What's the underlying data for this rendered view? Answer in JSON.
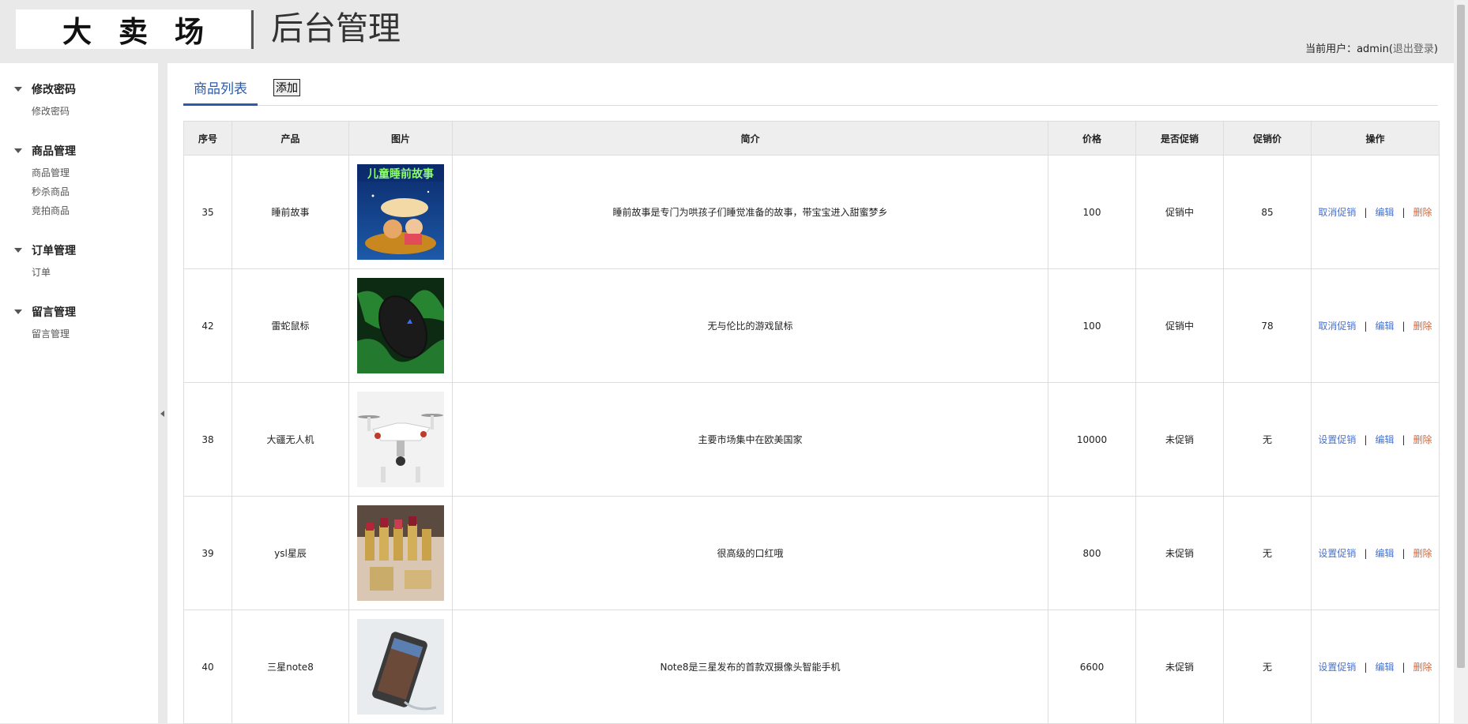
{
  "header": {
    "logo": "大卖场",
    "title": "后台管理",
    "user_prefix": "当前用户：admin(",
    "logout": "退出登录",
    "user_suffix": ")"
  },
  "sidebar": {
    "groups": [
      {
        "title": "修改密码",
        "items": [
          "修改密码"
        ]
      },
      {
        "title": "商品管理",
        "items": [
          "商品管理",
          "秒杀商品",
          "竞拍商品"
        ]
      },
      {
        "title": "订单管理",
        "items": [
          "订单"
        ]
      },
      {
        "title": "留言管理",
        "items": [
          "留言管理"
        ]
      }
    ]
  },
  "main": {
    "tab": "商品列表",
    "add_button": "添加",
    "columns": [
      "序号",
      "产品",
      "图片",
      "简介",
      "价格",
      "是否促销",
      "促销价",
      "操作"
    ],
    "ops": {
      "edit": "编辑",
      "delete": "删除",
      "sep": "|"
    },
    "rows": [
      {
        "id": "35",
        "product": "睡前故事",
        "desc": "睡前故事是专门为哄孩子们睡觉准备的故事，带宝宝进入甜蜜梦乡",
        "price": "100",
        "promo": "促销中",
        "promo_price": "85",
        "promo_op": "取消促销",
        "image_text": "儿童睡前故事"
      },
      {
        "id": "42",
        "product": "雷蛇鼠标",
        "desc": "无与伦比的游戏鼠标",
        "price": "100",
        "promo": "促销中",
        "promo_price": "78",
        "promo_op": "取消促销"
      },
      {
        "id": "38",
        "product": "大疆无人机",
        "desc": "主要市场集中在欧美国家",
        "price": "10000",
        "promo": "未促销",
        "promo_price": "无",
        "promo_op": "设置促销"
      },
      {
        "id": "39",
        "product": "ysl星辰",
        "desc": "很高级的口红哦",
        "price": "800",
        "promo": "未促销",
        "promo_price": "无",
        "promo_op": "设置促销"
      },
      {
        "id": "40",
        "product": "三星note8",
        "desc": "Note8是三星发布的首款双摄像头智能手机",
        "price": "6600",
        "promo": "未促销",
        "promo_price": "无",
        "promo_op": "设置促销"
      }
    ]
  }
}
